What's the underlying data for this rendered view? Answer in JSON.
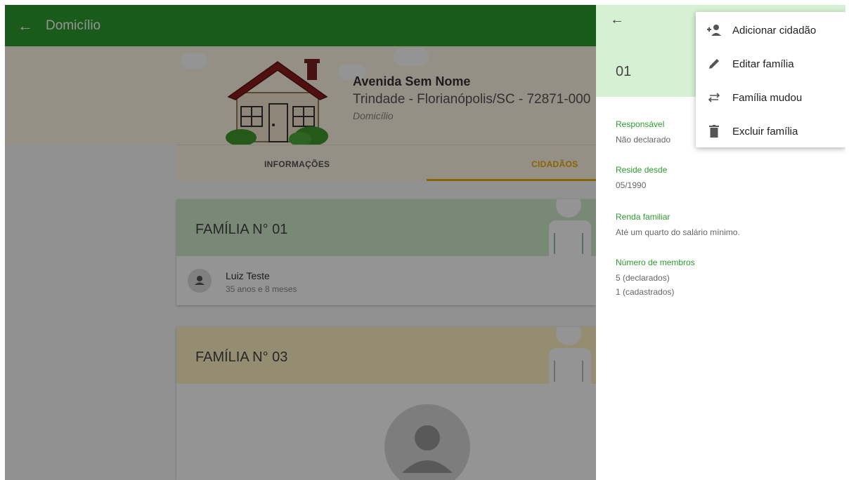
{
  "appbar": {
    "title": "Domicílio"
  },
  "address": {
    "street": "Avenida Sem Nome",
    "city": "Trindade - Florianópolis/SC - 72871-000",
    "type": "Domicílio"
  },
  "tabs": [
    {
      "label": "INFORMAÇÕES",
      "active": false
    },
    {
      "label": "CIDADÃOS",
      "active": true
    }
  ],
  "families": [
    {
      "title": "FAMÍLIA N° 01",
      "color": "#cfeecb",
      "members": [
        {
          "name": "Luiz Teste",
          "age": "35 anos e 8 meses"
        }
      ]
    },
    {
      "title": "FAMÍLIA N° 03",
      "color": "#fff3c4",
      "members": []
    }
  ],
  "panel": {
    "number": "01",
    "fields": {
      "responsible": {
        "label": "Responsável",
        "value": "Não declarado"
      },
      "since": {
        "label": "Reside desde",
        "value": "05/1990"
      },
      "income": {
        "label": "Renda familiar",
        "value": "Até um quarto do salário mínimo."
      },
      "members": {
        "label": "Número de membros",
        "declared": "5 (declarados)",
        "registered": "1 (cadastrados)"
      }
    }
  },
  "menu": [
    {
      "label": "Adicionar cidadão",
      "icon": "add-person-icon"
    },
    {
      "label": "Editar família",
      "icon": "pencil-icon"
    },
    {
      "label": "Família mudou",
      "icon": "swap-arrows-icon"
    },
    {
      "label": "Excluir família",
      "icon": "trash-icon"
    }
  ],
  "colors": {
    "primary": "#2e9b2e",
    "accent": "#f2a900",
    "panel_header": "#d6f0d4"
  }
}
